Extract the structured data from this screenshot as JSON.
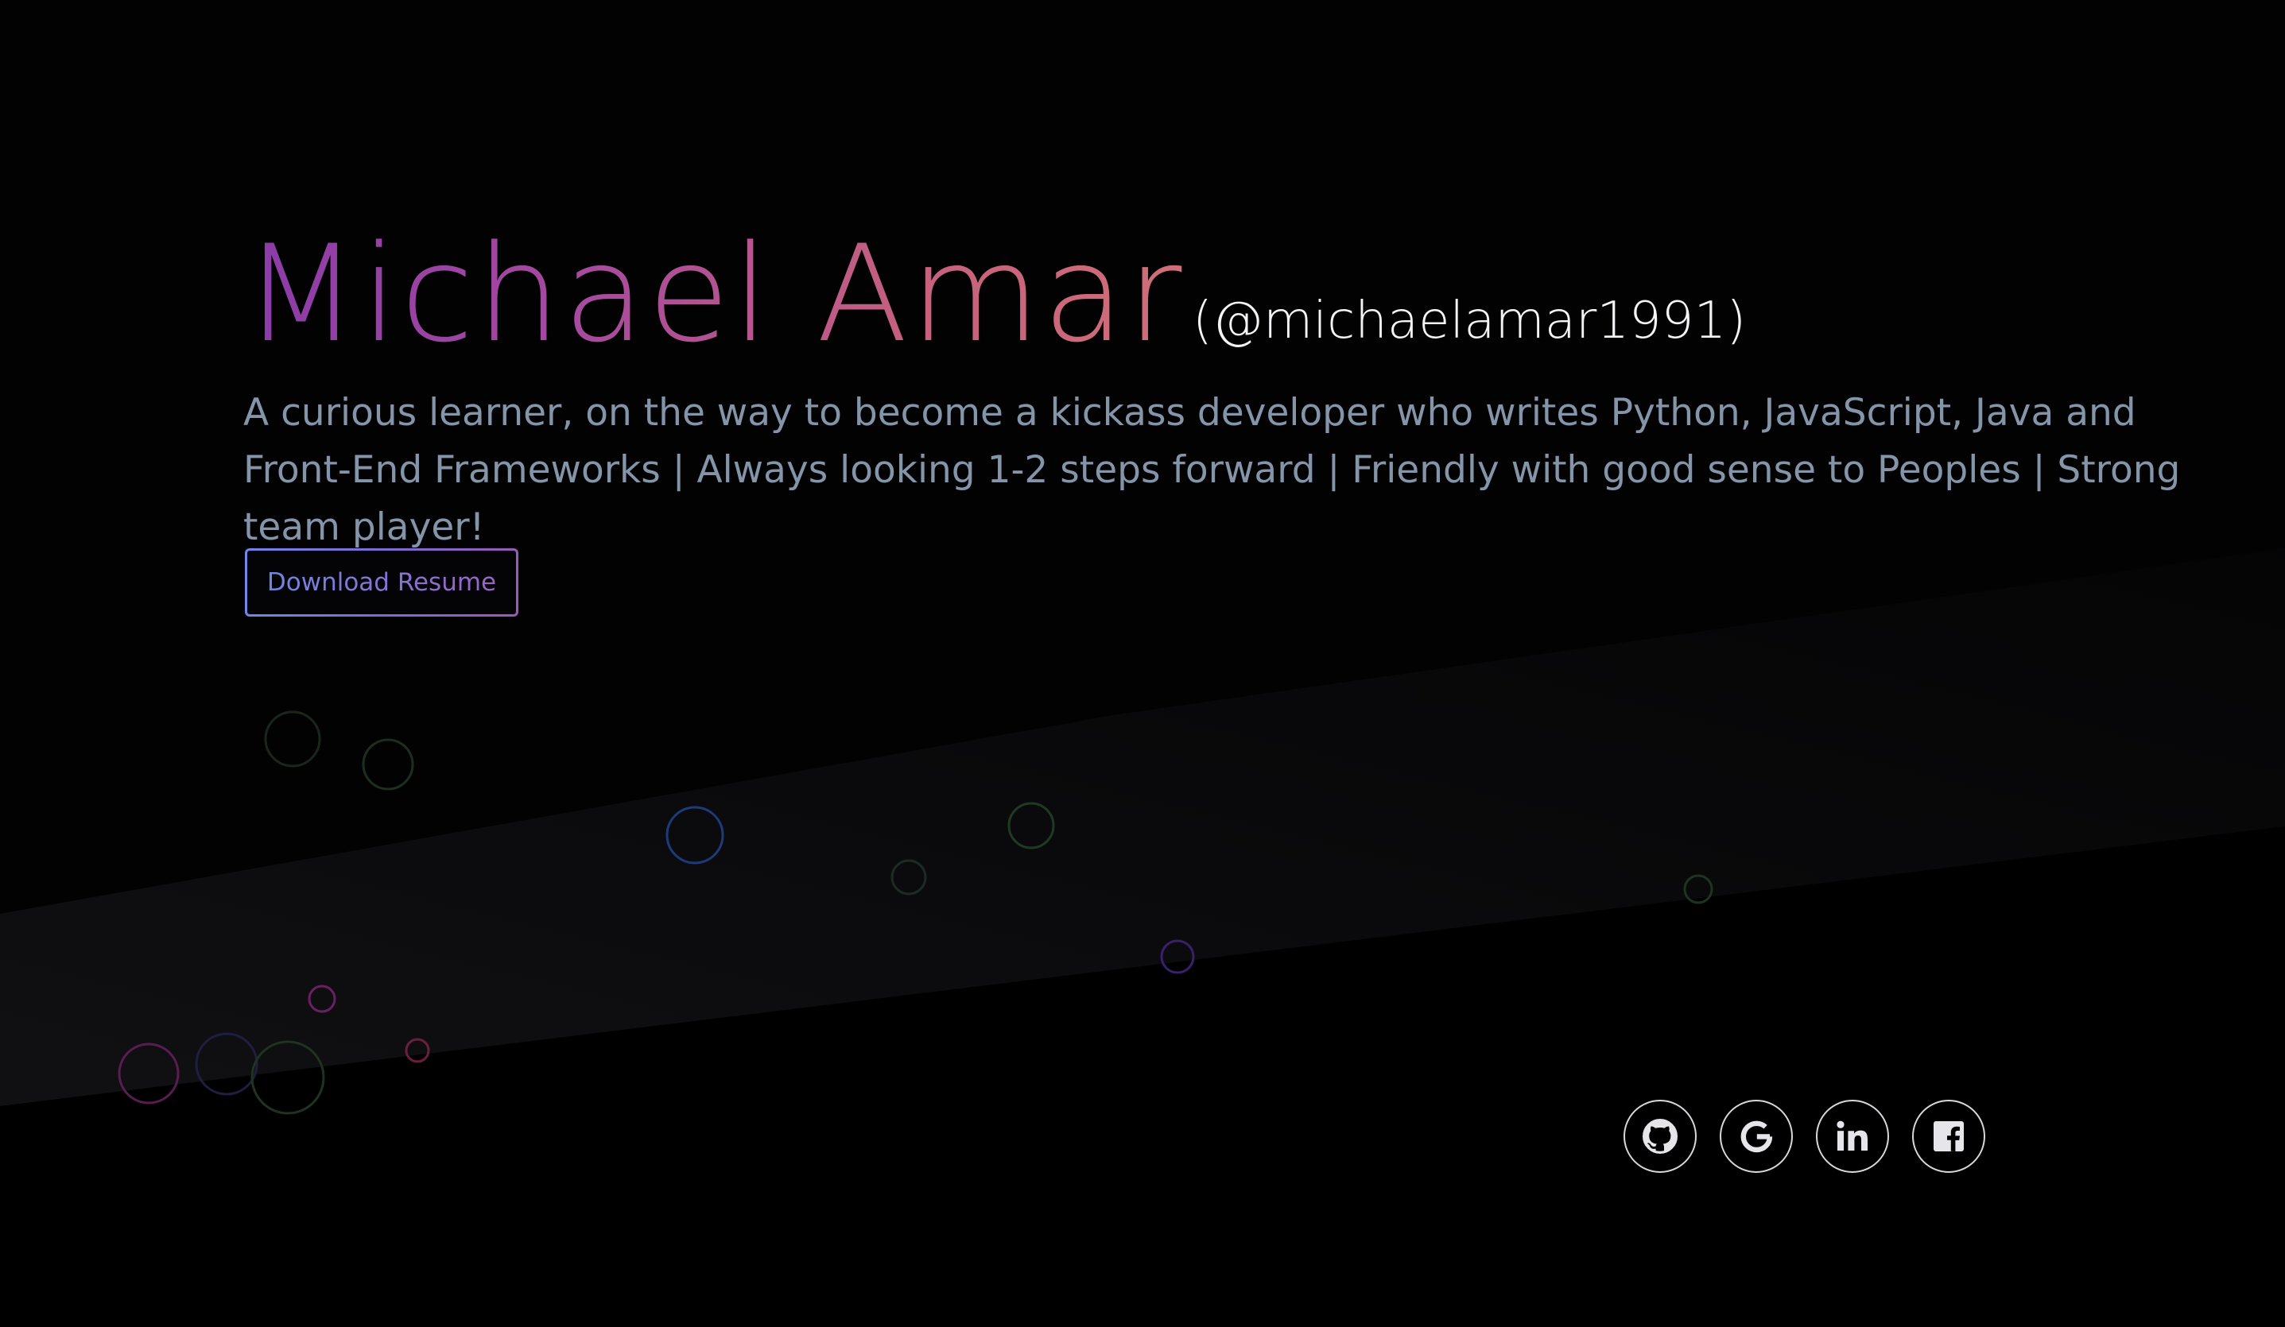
{
  "hero": {
    "name": "Michael Amar",
    "handle": "(@michaelamar1991)",
    "tagline": "A curious learner, on the way to become a kickass developer who writes Python, JavaScript, Java and Front-End Frameworks | Always looking 1-2 steps forward | Friendly with good sense to Peoples | Strong team player!",
    "resume_label": "Download Resume"
  },
  "social": {
    "links": [
      {
        "icon": "github-icon"
      },
      {
        "icon": "google-icon"
      },
      {
        "icon": "linkedin-icon"
      },
      {
        "icon": "facebook-icon"
      }
    ]
  },
  "colors": {
    "background": "#020203",
    "name_gradient_start": "#8b3ca8",
    "name_gradient_end": "#d06f78",
    "tagline": "#8495a9",
    "button_border_start": "#6c88e8",
    "button_border_end": "#9a5ab8",
    "social_border": "#d8d8dc"
  }
}
